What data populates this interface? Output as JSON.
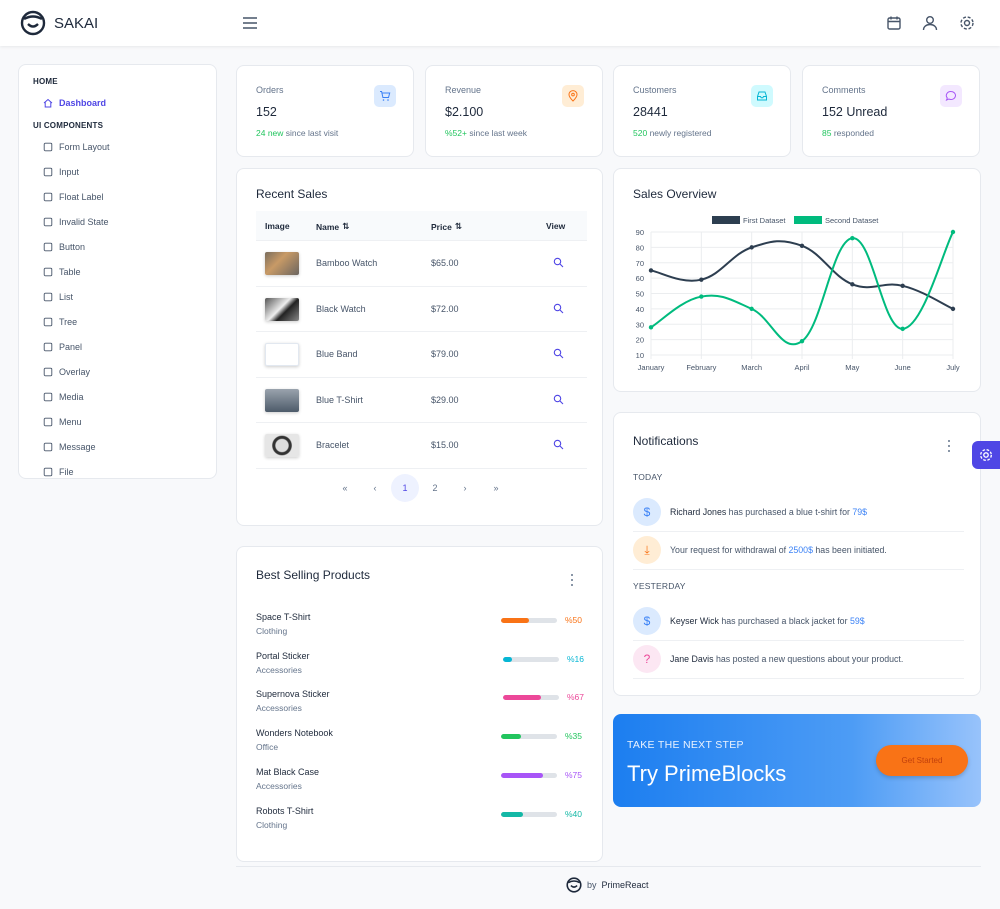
{
  "app": {
    "title": "SAKAI"
  },
  "sidebar": {
    "sections": [
      {
        "label": "HOME",
        "items": [
          {
            "label": "Dashboard",
            "icon": "home-icon",
            "active": true
          }
        ]
      },
      {
        "label": "UI COMPONENTS",
        "items": [
          {
            "label": "Form Layout",
            "icon": "id-card-icon"
          },
          {
            "label": "Input",
            "icon": "check-square-icon"
          },
          {
            "label": "Float Label",
            "icon": "bookmark-icon"
          },
          {
            "label": "Invalid State",
            "icon": "exclamation-circle-icon"
          },
          {
            "label": "Button",
            "icon": "mobile-icon"
          },
          {
            "label": "Table",
            "icon": "table-icon"
          },
          {
            "label": "List",
            "icon": "list-icon"
          },
          {
            "label": "Tree",
            "icon": "share-alt-icon"
          },
          {
            "label": "Panel",
            "icon": "tablet-icon"
          },
          {
            "label": "Overlay",
            "icon": "clone-icon"
          },
          {
            "label": "Media",
            "icon": "image-icon"
          },
          {
            "label": "Menu",
            "icon": "bars-icon"
          },
          {
            "label": "Message",
            "icon": "comment-icon"
          },
          {
            "label": "File",
            "icon": "file-icon"
          }
        ]
      }
    ]
  },
  "stats": [
    {
      "title": "Orders",
      "value": "152",
      "highlight": "24 new",
      "foot": "since last visit",
      "icon": "shopping-cart-icon",
      "icon_bg": "#dbeafe",
      "icon_color": "#3b82f6"
    },
    {
      "title": "Revenue",
      "value": "$2.100",
      "highlight": "%52+",
      "foot": "since last week",
      "icon": "map-marker-icon",
      "icon_bg": "#ffedd5",
      "icon_color": "#f97316"
    },
    {
      "title": "Customers",
      "value": "28441",
      "highlight": "520",
      "foot": "newly registered",
      "icon": "inbox-icon",
      "icon_bg": "#cffafe",
      "icon_color": "#06b6d4"
    },
    {
      "title": "Comments",
      "value": "152 Unread",
      "highlight": "85",
      "foot": "responded",
      "icon": "comment-icon",
      "icon_bg": "#f3e8ff",
      "icon_color": "#a855f7"
    }
  ],
  "recent_sales": {
    "title": "Recent Sales",
    "columns": {
      "image": "Image",
      "name": "Name",
      "price": "Price",
      "view": "View"
    },
    "rows": [
      {
        "name": "Bamboo Watch",
        "price": "$65.00"
      },
      {
        "name": "Black Watch",
        "price": "$72.00"
      },
      {
        "name": "Blue Band",
        "price": "$79.00"
      },
      {
        "name": "Blue T-Shirt",
        "price": "$29.00"
      },
      {
        "name": "Bracelet",
        "price": "$15.00"
      }
    ],
    "pager": {
      "first": "«",
      "prev": "‹",
      "pages": [
        "1",
        "2"
      ],
      "current": "1",
      "next": "›",
      "last": "»"
    }
  },
  "best_selling": {
    "title": "Best Selling Products",
    "items": [
      {
        "name": "Space T-Shirt",
        "category": "Clothing",
        "percent": 50,
        "label": "%50",
        "color": "#f97316"
      },
      {
        "name": "Portal Sticker",
        "category": "Accessories",
        "percent": 16,
        "label": "%16",
        "color": "#06b6d4"
      },
      {
        "name": "Supernova Sticker",
        "category": "Accessories",
        "percent": 67,
        "label": "%67",
        "color": "#ec4899"
      },
      {
        "name": "Wonders Notebook",
        "category": "Office",
        "percent": 35,
        "label": "%35",
        "color": "#22c55e"
      },
      {
        "name": "Mat Black Case",
        "category": "Accessories",
        "percent": 75,
        "label": "%75",
        "color": "#a855f7"
      },
      {
        "name": "Robots T-Shirt",
        "category": "Clothing",
        "percent": 40,
        "label": "%40",
        "color": "#14b8a6"
      }
    ]
  },
  "sales_overview": {
    "title": "Sales Overview"
  },
  "chart_data": {
    "type": "line",
    "categories": [
      "January",
      "February",
      "March",
      "April",
      "May",
      "June",
      "July"
    ],
    "series": [
      {
        "name": "First Dataset",
        "values": [
          65,
          59,
          80,
          81,
          56,
          55,
          40
        ],
        "color": "#2d3e50"
      },
      {
        "name": "Second Dataset",
        "values": [
          28,
          48,
          40,
          19,
          86,
          27,
          90
        ],
        "color": "#00bb7e"
      }
    ],
    "ylim": [
      10,
      90
    ],
    "yticks": [
      "90",
      "80",
      "70",
      "60",
      "50",
      "40",
      "30",
      "20",
      "10"
    ],
    "grid": true,
    "legend": "top"
  },
  "notifications": {
    "title": "Notifications",
    "groups": [
      {
        "label": "TODAY",
        "items": [
          {
            "icon": "dollar-icon",
            "bold": "Richard Jones",
            "text": " has purchased a blue t-shirt for ",
            "link": "79$",
            "after": "",
            "bg": "#dbeafe",
            "fg": "#3b82f6",
            "glyph": "$"
          },
          {
            "icon": "download-icon",
            "bold": "",
            "text": "Your request for withdrawal of ",
            "link": "2500$",
            "after": " has been initiated.",
            "bg": "#ffedd5",
            "fg": "#f97316",
            "glyph": "⤓"
          }
        ]
      },
      {
        "label": "YESTERDAY",
        "items": [
          {
            "icon": "dollar-icon",
            "bold": "Keyser Wick",
            "text": " has purchased a black jacket for ",
            "link": "59$",
            "after": "",
            "bg": "#dbeafe",
            "fg": "#3b82f6",
            "glyph": "$"
          },
          {
            "icon": "question-icon",
            "bold": "Jane Davis",
            "text": " has posted a new questions about your product.",
            "link": "",
            "after": "",
            "bg": "#fce7f3",
            "fg": "#ec4899",
            "glyph": "?"
          }
        ]
      }
    ]
  },
  "banner": {
    "subtitle": "TAKE THE NEXT STEP",
    "title": "Try PrimeBlocks",
    "button": "Get Started"
  },
  "footer": {
    "by": "by",
    "brand": "PrimeReact"
  }
}
